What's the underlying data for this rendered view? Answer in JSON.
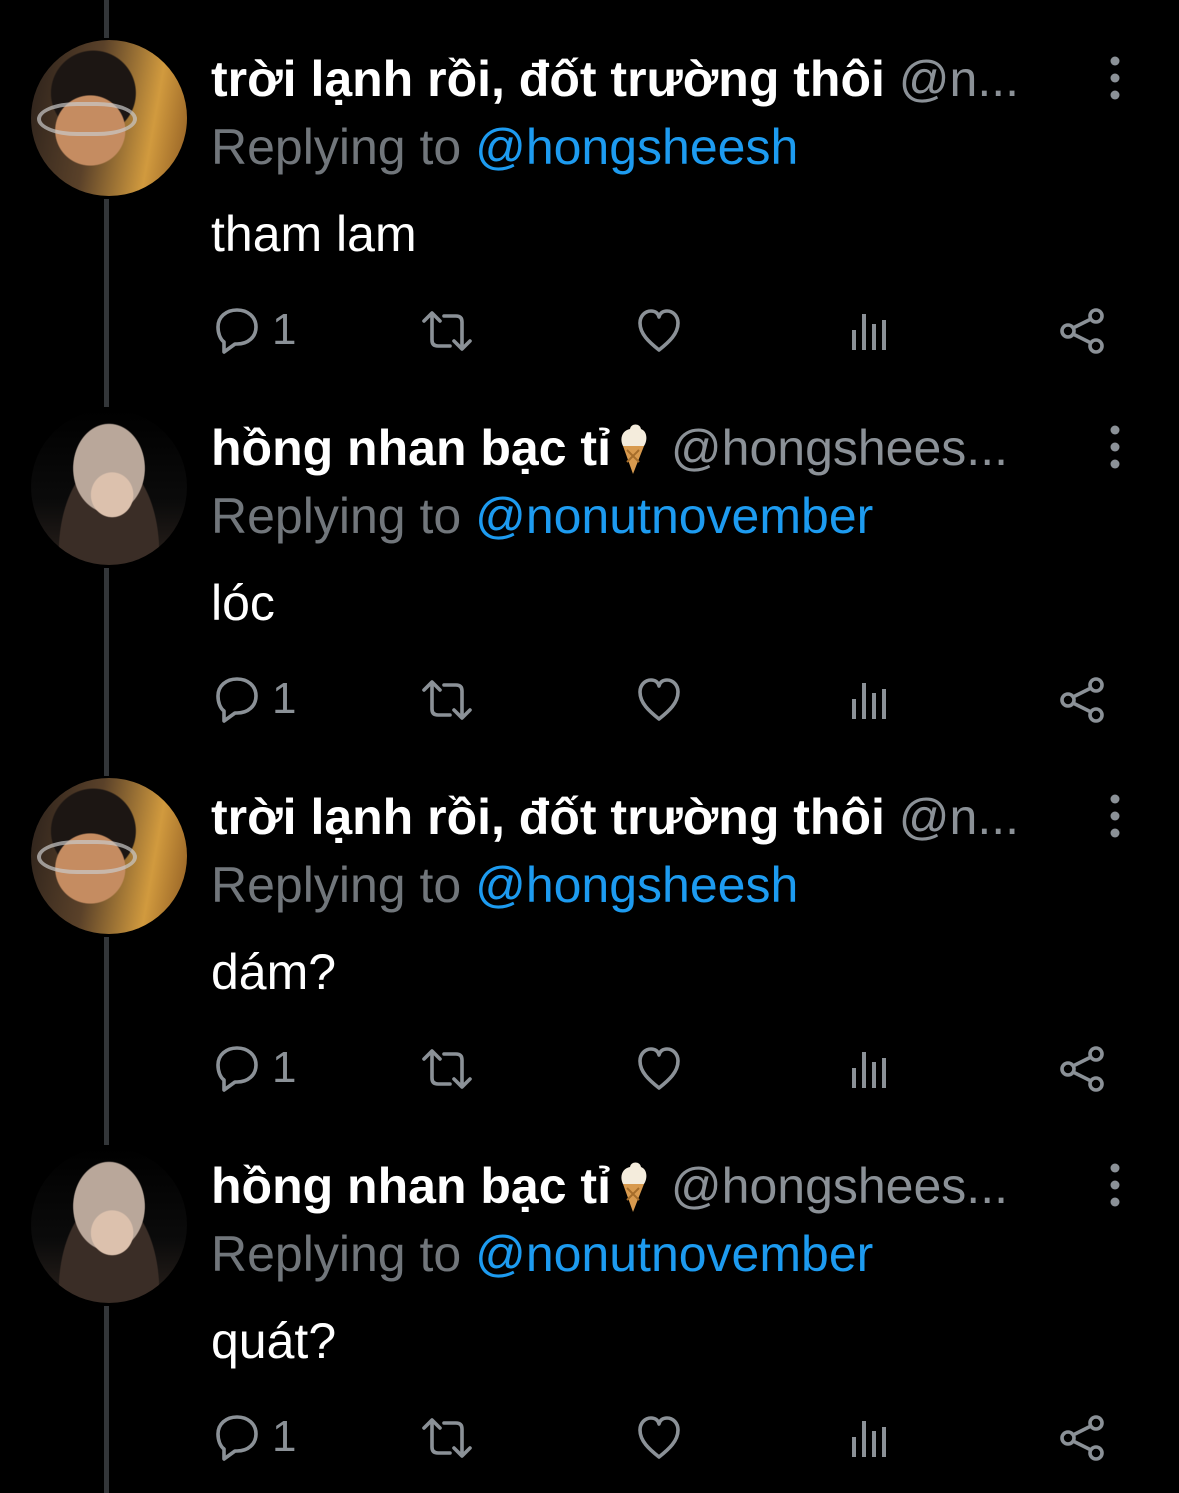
{
  "colors": {
    "background": "#000000",
    "name": "#ffffff",
    "secondary": "#71767b",
    "mention": "#1d9bf0",
    "thread_line": "#333639"
  },
  "icons": {
    "reply": "reply-bubble-icon",
    "retweet": "retweet-icon",
    "like": "heart-icon",
    "views": "views-bar-chart-icon",
    "share": "share-icon",
    "more": "more-vertical-icon"
  },
  "tweets": [
    {
      "display_name": "trời lạnh rồi, đốt trường thôi",
      "has_emoji": false,
      "handle": "@n...",
      "replying_prefix": "Replying to",
      "replying_to": "@hongsheesh",
      "text": "tham lam",
      "reply_count": "1"
    },
    {
      "display_name": "hồng nhan bạc tỉ",
      "has_emoji": true,
      "handle": "@hongshees...",
      "replying_prefix": "Replying to",
      "replying_to": "@nonutnovember",
      "text": "lóc",
      "reply_count": "1"
    },
    {
      "display_name": "trời lạnh rồi, đốt trường thôi",
      "has_emoji": false,
      "handle": "@n...",
      "replying_prefix": "Replying to",
      "replying_to": "@hongsheesh",
      "text": "dám?",
      "reply_count": "1"
    },
    {
      "display_name": "hồng nhan bạc tỉ",
      "has_emoji": true,
      "handle": "@hongshees...",
      "replying_prefix": "Replying to",
      "replying_to": "@nonutnovember",
      "text": "quát?",
      "reply_count": "1"
    }
  ]
}
